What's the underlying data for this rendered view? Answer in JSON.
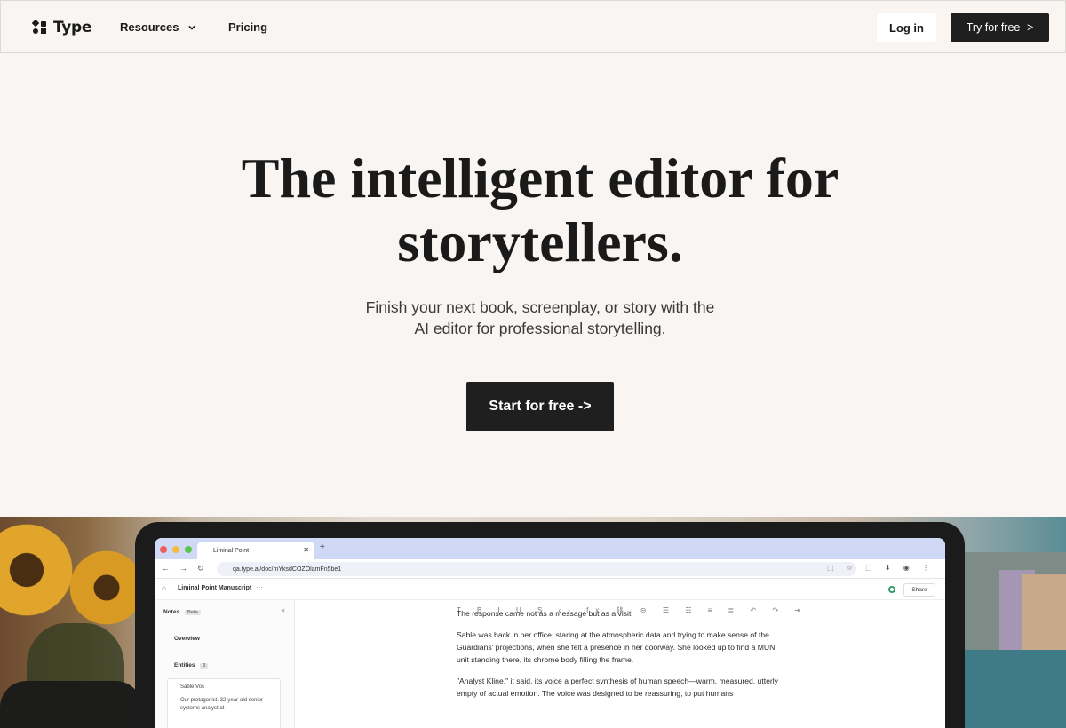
{
  "nav": {
    "logo_text": "Type",
    "resources_label": "Resources",
    "pricing_label": "Pricing",
    "login_label": "Log in",
    "try_label": "Try for free ->"
  },
  "hero": {
    "title_line1": "The intelligent editor for",
    "title_line2": "storytellers.",
    "subtitle_line1": "Finish your next book, screenplay, or story with the",
    "subtitle_line2": "AI editor for professional storytelling.",
    "cta_label": "Start for free ->"
  },
  "app_preview": {
    "tab_title": "Liminal Point",
    "url": "qa.type.ai/doc/mYksdCOZOlamFn5be1",
    "doc_title": "Liminal Point Manuscript",
    "share_label": "Share",
    "sidebar": {
      "notes_label": "Notes",
      "notes_badge": "Beta",
      "overview_label": "Overview",
      "entities_label": "Entities",
      "entities_count": "3",
      "entity_name": "Sable Vos",
      "entity_desc": "Our protagonist. 32-year-old senior systems analyst at"
    },
    "paragraphs": [
      "The response came not as a message but as a visit.",
      "Sable was back in her office, staring at the atmospheric data and trying to make sense of the Guardians' projections, when she felt a presence in her doorway. She looked up to find a MUNI unit standing there, its chrome body filling the frame.",
      "\"Analyst Kline,\" it said, its voice a perfect synthesis of human speech—warm, measured, utterly empty of actual emotion. The voice was designed to be reassuring, to put humans"
    ]
  },
  "colors": {
    "background": "#f8f5f2",
    "button_dark": "#1f1f1f",
    "text": "#1a1a1a"
  }
}
